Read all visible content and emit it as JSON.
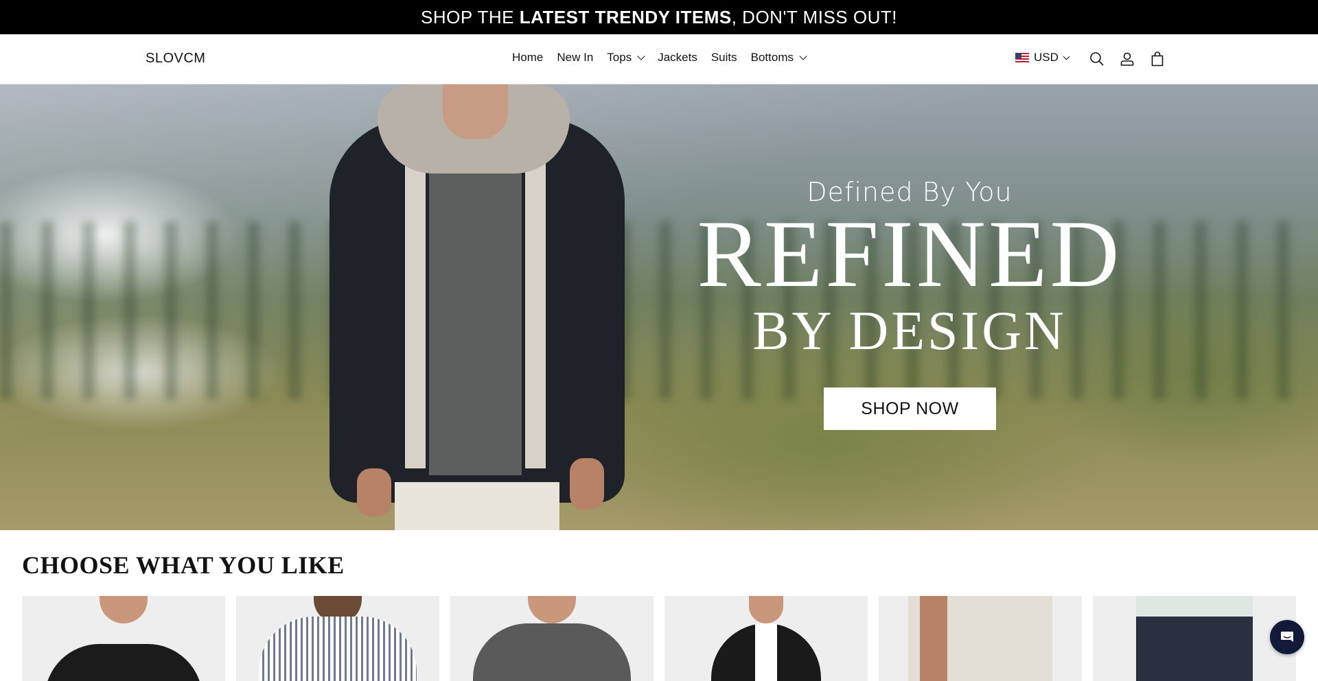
{
  "announcement": {
    "before": "SHOP THE ",
    "bold": "LATEST TRENDY ITEMS",
    "after": ", DON'T MISS OUT!"
  },
  "header": {
    "logo": "SLOVCM",
    "nav": [
      {
        "label": "Home",
        "has_dropdown": false
      },
      {
        "label": "New In",
        "has_dropdown": false
      },
      {
        "label": "Tops",
        "has_dropdown": true
      },
      {
        "label": "Jackets",
        "has_dropdown": false
      },
      {
        "label": "Suits",
        "has_dropdown": false
      },
      {
        "label": "Bottoms",
        "has_dropdown": true
      }
    ],
    "currency": "USD",
    "icons": [
      "search-icon",
      "account-icon",
      "cart-icon"
    ]
  },
  "hero": {
    "subtitle": "Defined By You",
    "title": "REFINED",
    "title2": "BY DESIGN",
    "cta": "SHOP NOW"
  },
  "collection": {
    "title": "CHOOSE WHAT YOU LIKE",
    "cards": [
      {
        "name": "black-tshirt",
        "color": "#1b1b1b"
      },
      {
        "name": "striped-shirt",
        "color": "#c6cbd6"
      },
      {
        "name": "grey-hoodie",
        "color": "#5a5a5a"
      },
      {
        "name": "black-blazer",
        "color": "#1a1a1a"
      },
      {
        "name": "linen-shirt",
        "color": "#e4dfd6"
      },
      {
        "name": "navy-chinos",
        "color": "#2a3040"
      }
    ]
  },
  "colors": {
    "announcement_bg": "#000000",
    "text": "#121212",
    "chat_bg": "#121a3a"
  }
}
